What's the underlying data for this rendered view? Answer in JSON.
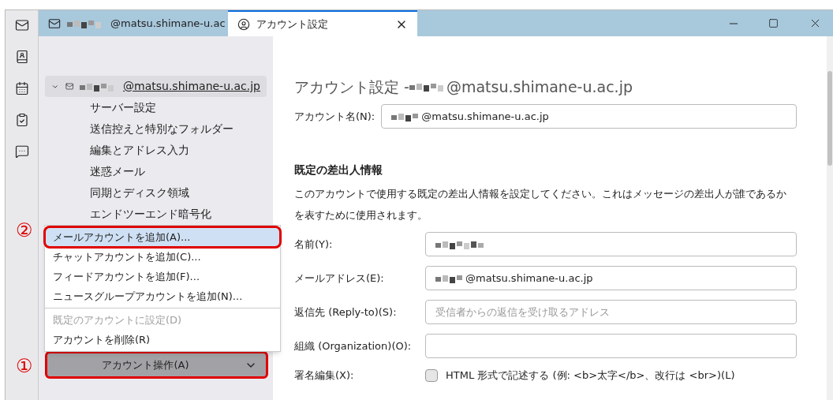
{
  "tabs": [
    {
      "title": "@matsu.shimane-u.ac",
      "selected": false,
      "redacted": true
    },
    {
      "title": "アカウント設定",
      "selected": true,
      "redacted": false
    }
  ],
  "sidebar": {
    "account": {
      "label": "@matsu.shimane-u.ac.jp",
      "expanded": true,
      "selected": true,
      "redacted": true
    },
    "items": [
      "サーバー設定",
      "送信控えと特別なフォルダー",
      "編集とアドレス入力",
      "迷惑メール",
      "同期とディスク領域",
      "エンドツーエンド暗号化"
    ]
  },
  "account_menu": [
    {
      "kind": "action",
      "label": "メールアカウントを追加(A)...",
      "selected": true,
      "disabled": false,
      "callout": "②"
    },
    {
      "kind": "action",
      "label": "チャットアカウントを追加(C)...",
      "selected": false,
      "disabled": false
    },
    {
      "kind": "action",
      "label": "フィードアカウントを追加(F)...",
      "selected": false,
      "disabled": false
    },
    {
      "kind": "action",
      "label": "ニュースグループアカウントを追加(N)...",
      "selected": false,
      "disabled": false
    },
    {
      "kind": "separator"
    },
    {
      "kind": "action",
      "label": "既定のアカウントに設定(D)",
      "selected": false,
      "disabled": true
    },
    {
      "kind": "action",
      "label": "アカウントを削除(R)",
      "selected": false,
      "disabled": false
    }
  ],
  "account_actions_button": {
    "label": "アカウント操作(A)",
    "callout": "①"
  },
  "content": {
    "title": "アカウント設定 - ",
    "title_email": "@matsu.shimane-u.ac.jp",
    "account_name": {
      "label": "アカウント名(N):",
      "value": "@matsu.shimane-u.ac.jp",
      "redacted": true
    },
    "section_heading": "既定の差出人情報",
    "description": "このアカウントで使用する既定の差出人情報を設定してください。これはメッセージの差出人が誰であるかを表すために使用されます。",
    "fields": [
      {
        "label": "名前(Y):",
        "redacted": true
      },
      {
        "label": "メールアドレス(E):",
        "value": "@matsu.shimane-u.ac.jp",
        "redacted": true
      },
      {
        "label": "返信先 (Reply-to)(S):",
        "placeholder": "受信者からの返信を受け取るアドレス",
        "redacted": false
      },
      {
        "label": "組織 (Organization)(O):",
        "redacted": false
      }
    ],
    "signature": {
      "label": "署名編集(X):",
      "checkbox_label": "HTML 形式で記述する (例: <b>太字</b>、改行は <br>)(L)",
      "checked": false
    }
  }
}
